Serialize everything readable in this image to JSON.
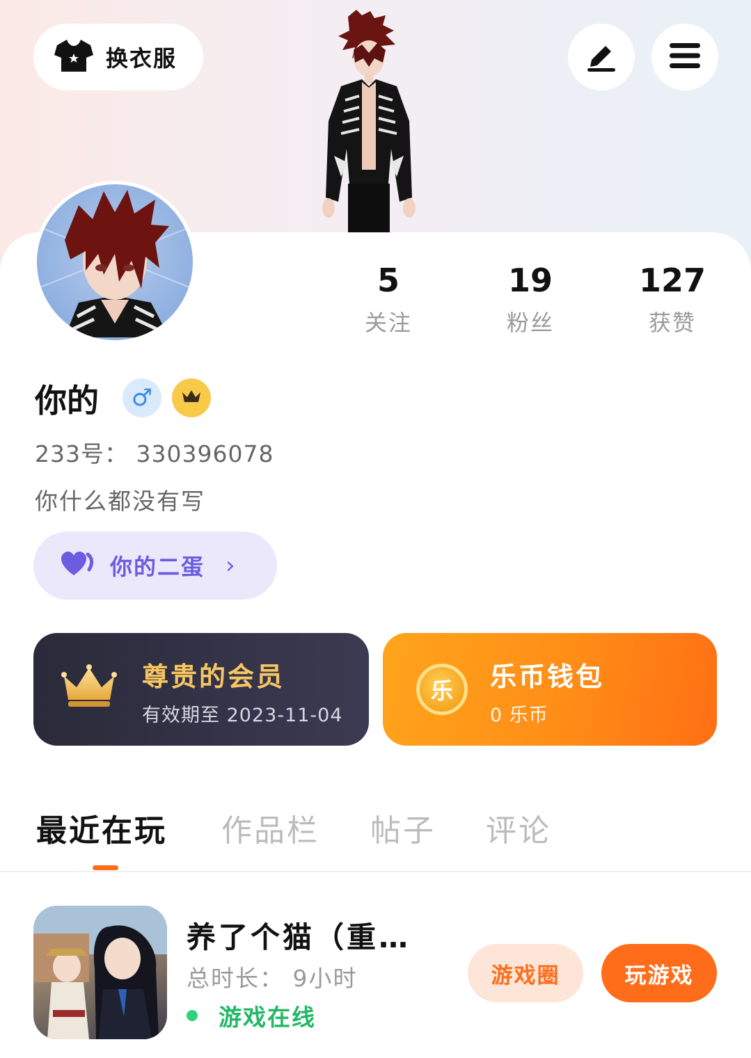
{
  "header": {
    "outfit_label": "换衣服",
    "outfit_icon": "tshirt-icon",
    "edit_icon": "pencil-icon",
    "menu_icon": "menu-icon"
  },
  "profile": {
    "name": "你的",
    "gender_symbol": "♂",
    "uid": "233号： 330396078",
    "bio": "你什么都没有写",
    "egg_label": "你的二蛋"
  },
  "stats": [
    {
      "value": "5",
      "label": "关注"
    },
    {
      "value": "19",
      "label": "粉丝"
    },
    {
      "value": "127",
      "label": "获赞"
    }
  ],
  "vip_card": {
    "title": "尊贵的会员",
    "subtitle": "有效期至 2023-11-04"
  },
  "wallet_card": {
    "title": "乐币钱包",
    "subtitle": "0 乐币",
    "coin_glyph": "乐"
  },
  "tabs": [
    {
      "label": "最近在玩",
      "active": true
    },
    {
      "label": "作品栏",
      "active": false
    },
    {
      "label": "帖子",
      "active": false
    },
    {
      "label": "评论",
      "active": false
    }
  ],
  "recent_game": {
    "title": "养了个猫（重…",
    "duration": "总时长： 9小时",
    "status": "游戏在线",
    "circle_label": "游戏圈",
    "play_label": "玩游戏"
  },
  "colors": {
    "accent_orange": "#ff6d1a",
    "vip_gold": "#f7c663",
    "online_green": "#22b866",
    "egg_purple": "#6b5ce0"
  }
}
